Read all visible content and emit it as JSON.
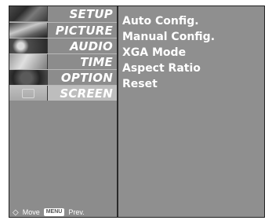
{
  "sidebar": {
    "items": [
      {
        "label": "SETUP",
        "thumb": "setup",
        "selected": false
      },
      {
        "label": "PICTURE",
        "thumb": "picture",
        "selected": false
      },
      {
        "label": "AUDIO",
        "thumb": "audio",
        "selected": false
      },
      {
        "label": "TIME",
        "thumb": "time",
        "selected": false
      },
      {
        "label": "OPTION",
        "thumb": "option",
        "selected": false
      },
      {
        "label": "SCREEN",
        "thumb": "screen",
        "selected": true
      }
    ]
  },
  "screen_menu": {
    "items": [
      "Auto Config.",
      "Manual Config.",
      "XGA Mode",
      "Aspect Ratio",
      "Reset"
    ]
  },
  "footer": {
    "move_label": "Move",
    "menu_key": "MENU",
    "prev_label": "Prev."
  },
  "colors": {
    "panel": "#8f8f8f",
    "selected_row": "#bdbdbd",
    "text": "#ffffff"
  }
}
